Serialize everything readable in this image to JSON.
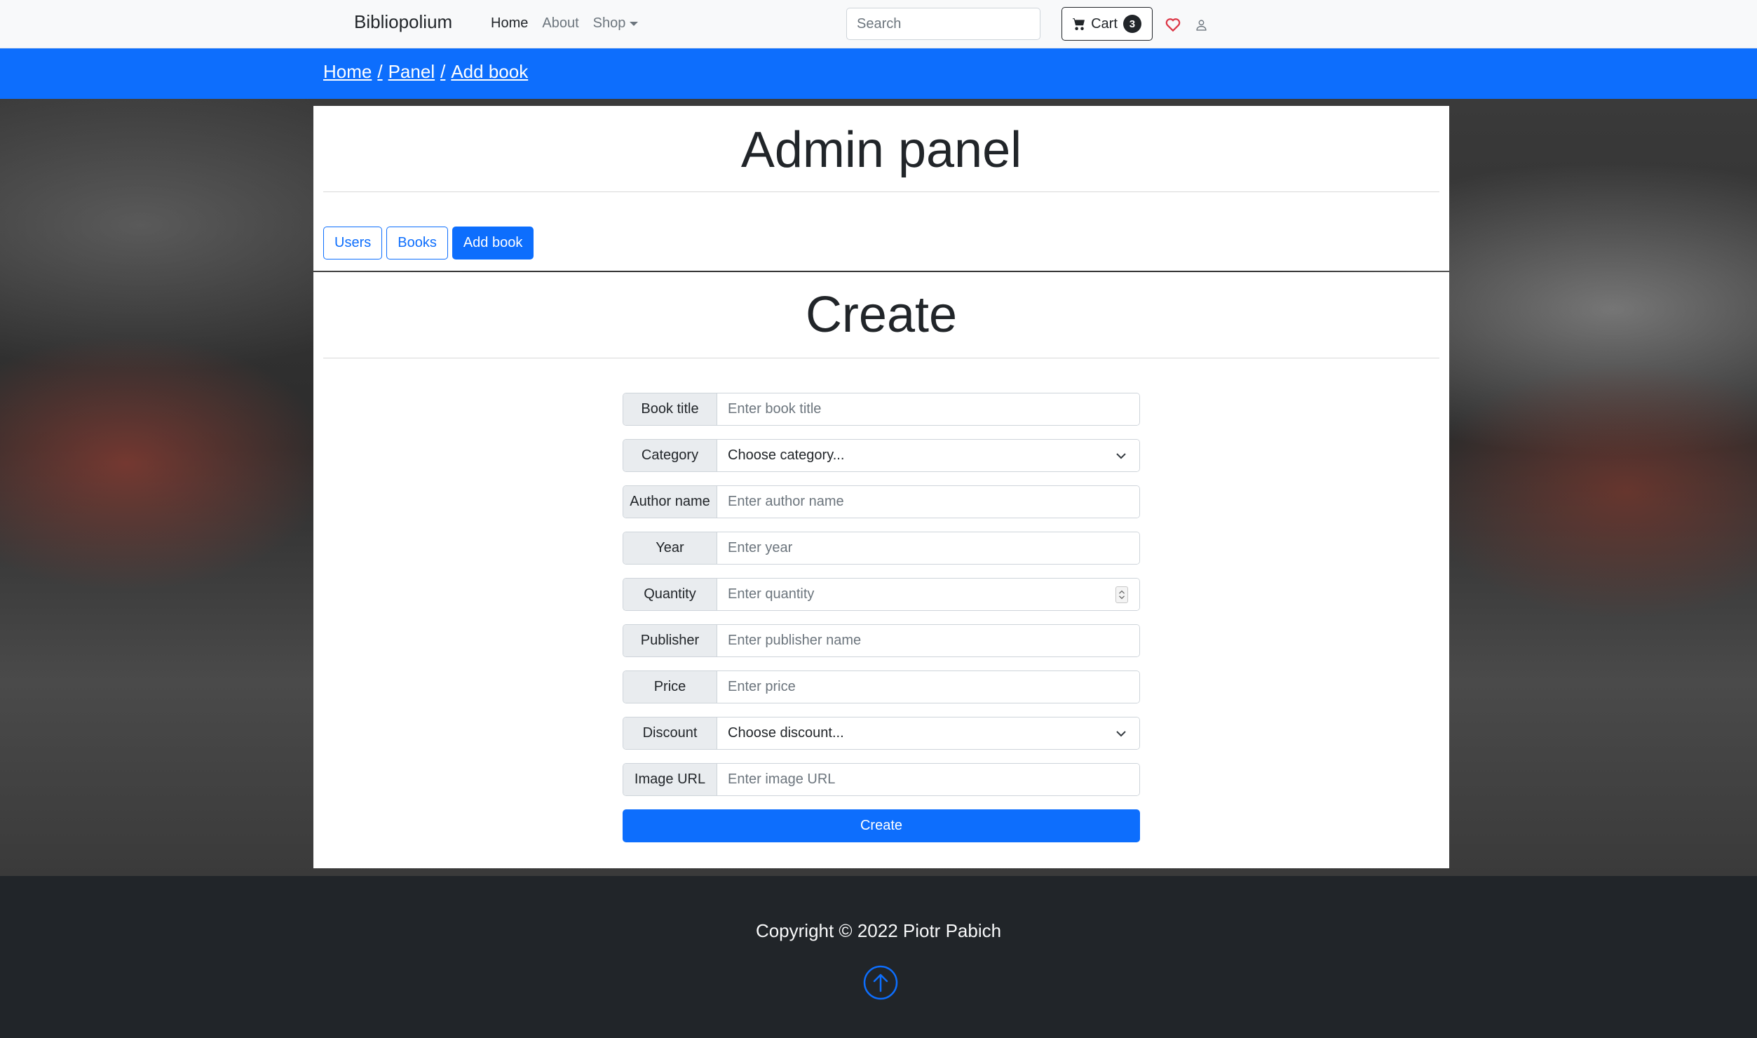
{
  "navbar": {
    "brand": "Bibliopolium",
    "links": [
      {
        "label": "Home"
      },
      {
        "label": "About"
      },
      {
        "label": "Shop"
      }
    ],
    "search_placeholder": "Search",
    "cart_label": "Cart",
    "cart_count": "3",
    "icons": [
      "cart-icon",
      "heart-icon",
      "user-icon"
    ]
  },
  "breadcrumb": {
    "items": [
      "Home",
      "Panel",
      "Add book"
    ],
    "separator": "/"
  },
  "panel": {
    "title": "Admin panel",
    "tabs": [
      {
        "label": "Users",
        "active": false
      },
      {
        "label": "Books",
        "active": false
      },
      {
        "label": "Add book",
        "active": true
      }
    ]
  },
  "form": {
    "title": "Create",
    "fields": {
      "book_title": {
        "label": "Book title",
        "placeholder": "Enter book title"
      },
      "category": {
        "label": "Category",
        "selected": "Choose category..."
      },
      "author_name": {
        "label": "Author name",
        "placeholder": "Enter author name"
      },
      "year": {
        "label": "Year",
        "placeholder": "Enter year"
      },
      "quantity": {
        "label": "Quantity",
        "placeholder": "Enter quantity"
      },
      "publisher": {
        "label": "Publisher",
        "placeholder": "Enter publisher name"
      },
      "price": {
        "label": "Price",
        "placeholder": "Enter price"
      },
      "discount": {
        "label": "Discount",
        "selected": "Choose discount..."
      },
      "image_url": {
        "label": "Image URL",
        "placeholder": "Enter image URL"
      }
    },
    "submit_label": "Create"
  },
  "footer": {
    "copyright": "Copyright © 2022 Piotr Pabich"
  },
  "colors": {
    "primary": "#0d6efd",
    "navbar_bg": "#f8f9fa",
    "footer_bg": "#212529",
    "heart": "#dc3545"
  }
}
